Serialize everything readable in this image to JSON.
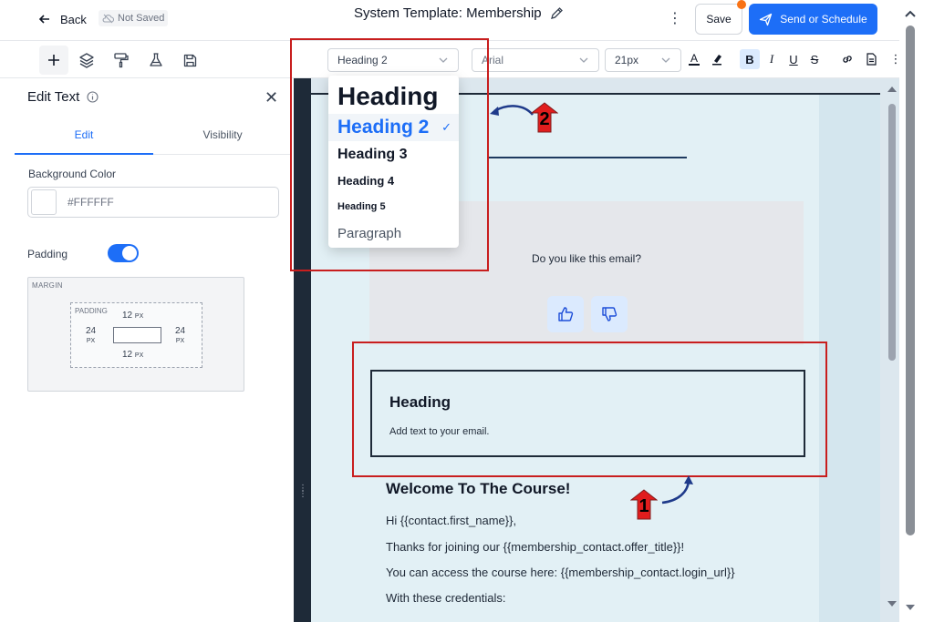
{
  "header": {
    "back_label": "Back",
    "save_status": "Not Saved",
    "title": "System Template: Membership",
    "save_label": "Save",
    "send_label": "Send or Schedule"
  },
  "toolbar": {
    "block_style": "Heading 2",
    "font_family": "Arial",
    "font_size": "21px",
    "bold_label": "B",
    "italic_label": "I",
    "underline_label": "U",
    "strike_label": "S",
    "text_color_label": "A"
  },
  "heading_menu": {
    "items": [
      "Heading",
      "Heading 2",
      "Heading 3",
      "Heading 4",
      "Heading 5",
      "Paragraph"
    ],
    "selected": "Heading 2"
  },
  "panel": {
    "title": "Edit Text",
    "tabs": [
      "Edit",
      "Visibility"
    ],
    "active_tab": "Edit",
    "background_color_label": "Background Color",
    "background_color_value": "#FFFFFF",
    "padding_label": "Padding",
    "padding_enabled": true,
    "margin_label": "MARGIN",
    "padding_box_label": "PADDING",
    "padding": {
      "top": "12",
      "right": "24",
      "bottom": "12",
      "left": "24",
      "unit": "PX"
    }
  },
  "email": {
    "feedback_question": "Do you like this email?",
    "text_block_heading": "Heading",
    "text_block_body": "Add text to your email.",
    "welcome_heading": "Welcome To The Course!",
    "body_lines": [
      "Hi {{contact.first_name}},",
      "Thanks for joining our {{membership_contact.offer_title}}!",
      "You can access the course here: {{membership_contact.login_url}}",
      "With these credentials:"
    ]
  },
  "annotations": {
    "badge_1": "1",
    "badge_2": "2"
  },
  "colors": {
    "accent": "#1d6ef7",
    "annotation_red": "#c81e1e",
    "canvas_dark": "#1e2a38"
  }
}
